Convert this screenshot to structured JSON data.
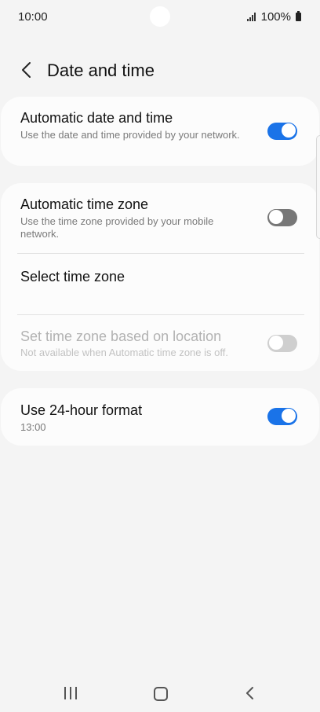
{
  "status": {
    "time": "10:00",
    "battery": "100%"
  },
  "header": {
    "title": "Date and time"
  },
  "settings": {
    "auto_datetime": {
      "title": "Automatic date and time",
      "subtitle": "Use the date and time provided by your network.",
      "enabled": true
    },
    "auto_timezone": {
      "title": "Automatic time zone",
      "subtitle": "Use the time zone provided by your mobile network.",
      "enabled": false
    },
    "select_timezone": {
      "title": "Select time zone"
    },
    "location_timezone": {
      "title": "Set time zone based on location",
      "subtitle": "Not available when Automatic time zone is off.",
      "enabled": false,
      "available": false
    },
    "format_24h": {
      "title": "Use 24-hour format",
      "subtitle": "13:00",
      "enabled": true
    }
  },
  "colors": {
    "accent": "#1a73e8",
    "background": "#f4f4f4",
    "card": "#fcfcfc"
  }
}
